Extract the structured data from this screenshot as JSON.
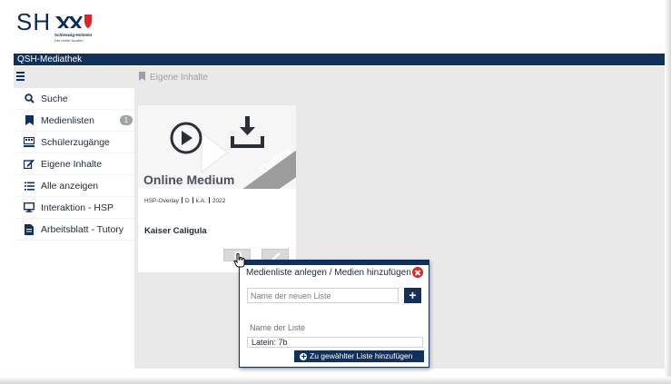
{
  "header": {
    "logo_text": "SH",
    "logo_line1": "Schleswig-Holstein",
    "logo_line2": "Der echte Norden",
    "app_title": "QSH-Mediathek"
  },
  "breadcrumb": {
    "label": "Eigene Inhalte",
    "icon": "bookmark-icon"
  },
  "sidebar": {
    "items": [
      {
        "label": "Suche",
        "icon": "search-icon"
      },
      {
        "label": "Medienlisten",
        "icon": "bookmark-icon",
        "badge": "1"
      },
      {
        "label": "Schülerzugänge",
        "icon": "classroom-icon"
      },
      {
        "label": "Eigene Inhalte",
        "icon": "edit-icon"
      },
      {
        "label": "Alle anzeigen",
        "icon": "list-icon"
      },
      {
        "label": "Interaktion - HSP",
        "icon": "monitor-icon"
      },
      {
        "label": "Arbeitsblatt - Tutory",
        "icon": "document-icon"
      }
    ]
  },
  "card": {
    "title": "Online Medium",
    "ribbon": "Online",
    "meta": [
      "HSP-Overlay",
      "D",
      "k.A.",
      "2022"
    ],
    "name": "Kaiser Caligula"
  },
  "popup": {
    "title": "Medienliste anlegen / Medien hinzufügen",
    "new_list_placeholder": "Name der neuen Liste",
    "add_label": "+",
    "list_label": "Name der Liste",
    "selected_list": "Latein: 7b",
    "submit_label": "Zu gewählter Liste hinzufügen"
  },
  "colors": {
    "primary": "#12305c",
    "close": "#d72a2a",
    "background": "#e9e9e9"
  }
}
